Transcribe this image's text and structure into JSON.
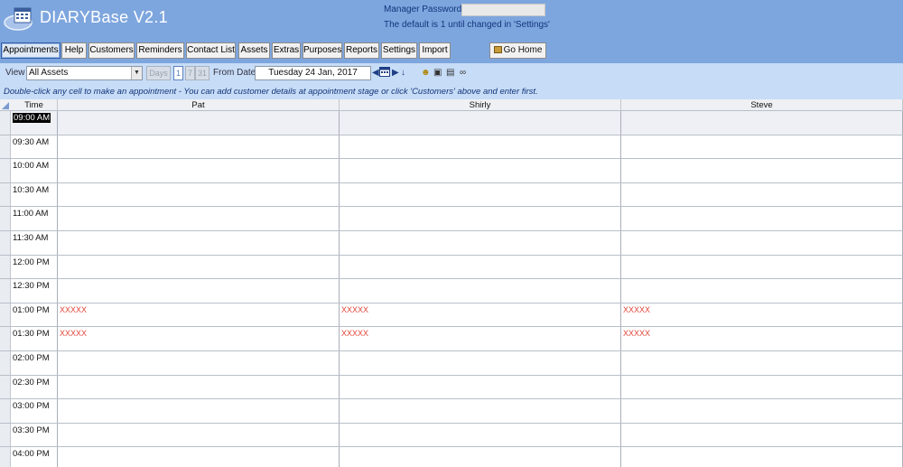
{
  "app": {
    "title": "DIARYBase V2.1",
    "password_label": "Manager Password",
    "password_value": "",
    "password_note": "The default is 1 until changed in 'Settings'"
  },
  "nav": {
    "items": [
      {
        "label": "Appointments",
        "active": true
      },
      {
        "label": "Help"
      },
      {
        "label": "Customers"
      },
      {
        "label": "Reminders"
      },
      {
        "label": "Contact List"
      },
      {
        "label": "Assets"
      },
      {
        "label": "Extras"
      },
      {
        "label": "Purposes"
      },
      {
        "label": "Reports"
      },
      {
        "label": "Settings"
      },
      {
        "label": "Import"
      }
    ],
    "go_home": "Go Home"
  },
  "toolbar": {
    "view_label": "View",
    "view_value": "All Assets",
    "days_label": "Days",
    "day_options": [
      "1",
      "7",
      "31"
    ],
    "selected_day": "1",
    "from_date_label": "From Date",
    "from_date_value": "Tuesday 24 Jan, 2017",
    "hint": "Double-click any cell to make an appointment - You can add customer details at appointment stage  or click 'Customers' above and enter first."
  },
  "grid": {
    "time_header": "Time",
    "columns": [
      "Pat",
      "Shirly",
      "Steve"
    ],
    "rows": [
      {
        "time": "09:00 AM",
        "cells": [
          "",
          "",
          ""
        ]
      },
      {
        "time": "09:30 AM",
        "cells": [
          "",
          "",
          ""
        ]
      },
      {
        "time": "10:00 AM",
        "cells": [
          "",
          "",
          ""
        ]
      },
      {
        "time": "10:30 AM",
        "cells": [
          "",
          "",
          ""
        ]
      },
      {
        "time": "11:00 AM",
        "cells": [
          "",
          "",
          ""
        ]
      },
      {
        "time": "11:30 AM",
        "cells": [
          "",
          "",
          ""
        ]
      },
      {
        "time": "12:00 PM",
        "cells": [
          "",
          "",
          ""
        ]
      },
      {
        "time": "12:30 PM",
        "cells": [
          "",
          "",
          ""
        ]
      },
      {
        "time": "01:00 PM",
        "cells": [
          "XXXXX",
          "XXXXX",
          "XXXXX"
        ]
      },
      {
        "time": "01:30 PM",
        "cells": [
          "XXXXX",
          "XXXXX",
          "XXXXX"
        ]
      },
      {
        "time": "02:00 PM",
        "cells": [
          "",
          "",
          ""
        ]
      },
      {
        "time": "02:30 PM",
        "cells": [
          "",
          "",
          ""
        ]
      },
      {
        "time": "03:00 PM",
        "cells": [
          "",
          "",
          ""
        ]
      },
      {
        "time": "03:30 PM",
        "cells": [
          "",
          "",
          ""
        ]
      },
      {
        "time": "04:00 PM",
        "cells": [
          "",
          "",
          ""
        ]
      }
    ]
  },
  "colors": {
    "header_bg": "#7ea6de",
    "toolbar_bg": "#c7dcf6",
    "blocked_text": "#e0463a"
  }
}
